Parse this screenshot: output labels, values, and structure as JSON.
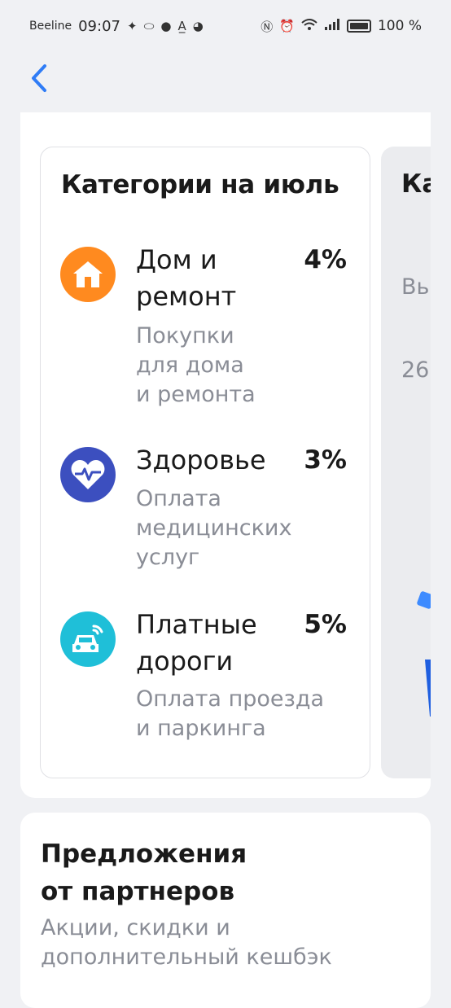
{
  "status_bar": {
    "carrier": "Beeline",
    "time": "09:07",
    "battery": "100 %"
  },
  "categories": {
    "title": "Категории на июль",
    "items": [
      {
        "name_line1": "Дом и",
        "name_line2": "ремонт",
        "percent": "4%",
        "desc": [
          "Покупки",
          "для дома",
          "и ремонта"
        ],
        "icon": "house-icon",
        "color": "#ff8a1f"
      },
      {
        "name_line1": "Здоровье",
        "name_line2": "",
        "percent": "3%",
        "desc": [
          "Оплата",
          "медицинских",
          "услуг"
        ],
        "icon": "heart-pulse-icon",
        "color": "#3c4fbf"
      },
      {
        "name_line1": "Платные",
        "name_line2": "дороги",
        "percent": "5%",
        "desc": [
          "Оплата проезда",
          "и паркинга"
        ],
        "icon": "car-icon",
        "color": "#1fbfd8"
      }
    ]
  },
  "next_card": {
    "title": "Ка",
    "subtitle_line1": "Вь",
    "subtitle_line2": "26"
  },
  "partners": {
    "title_line1": "Предложения",
    "title_line2": "от партнеров",
    "subtitle_line1": "Акции, скидки и",
    "subtitle_line2": "дополнительный кешбэк"
  },
  "colors": {
    "accent": "#2f7cf6",
    "background": "#f0f1f4",
    "muted_text": "#8a8d96"
  }
}
